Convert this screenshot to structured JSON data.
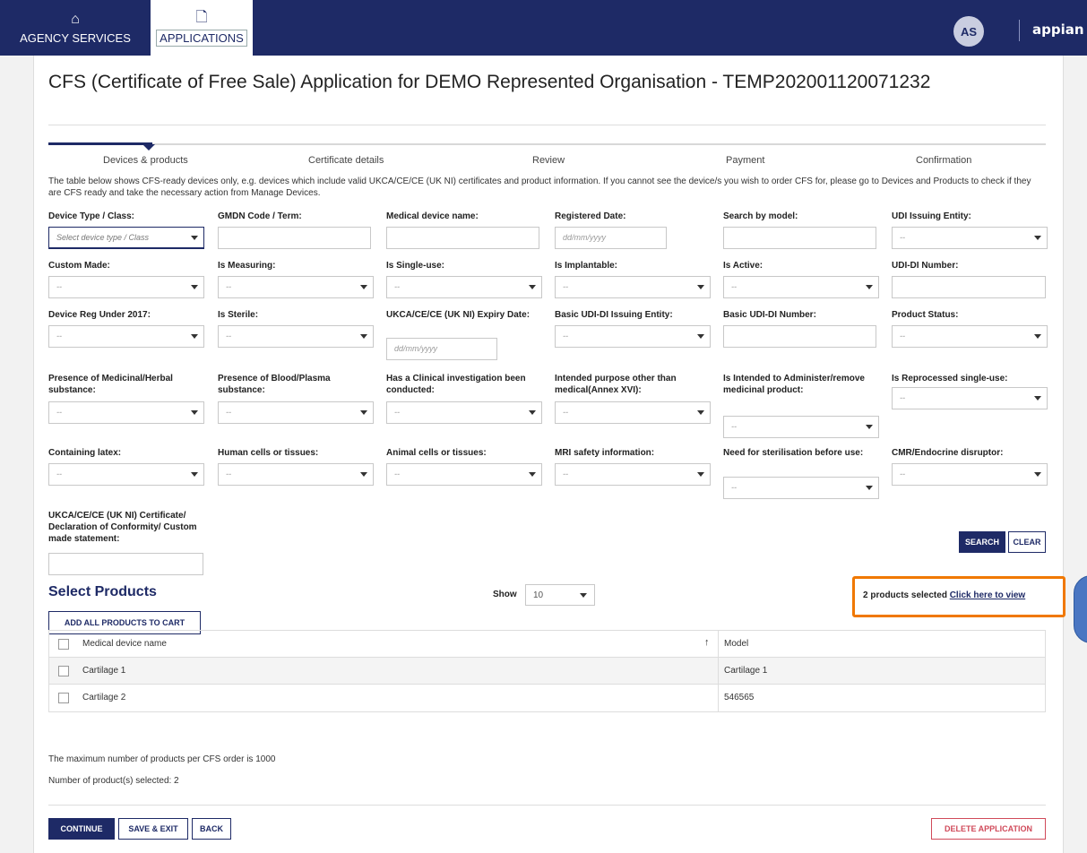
{
  "nav": {
    "agency_label": "AGENCY SERVICES",
    "applications_label": "APPLICATIONS",
    "avatar_initials": "AS",
    "brand": "appian"
  },
  "page": {
    "title": "CFS (Certificate of Free Sale) Application for DEMO Represented Organisation - TEMP202001120071232"
  },
  "steps": [
    "Devices & products",
    "Certificate details",
    "Review",
    "Payment",
    "Confirmation"
  ],
  "info_text": "The table below shows CFS-ready devices only, e.g. devices which include valid UKCA/CE/CE (UK NI) certificates and product information. If you cannot see the device/s you wish to order CFS for, please go to Devices and Products to check if they are CFS ready and take the necessary action from Manage Devices.",
  "filters": {
    "device_type": {
      "label": "Device Type / Class:",
      "placeholder": "Select device type / Class"
    },
    "gmdn": {
      "label": "GMDN Code / Term:"
    },
    "medical_device_name": {
      "label": "Medical device name:"
    },
    "registered_date": {
      "label": "Registered Date:",
      "placeholder": "dd/mm/yyyy"
    },
    "search_by_model": {
      "label": "Search by model:"
    },
    "udi_issuing_entity": {
      "label": "UDI Issuing Entity:",
      "placeholder": "--"
    },
    "custom_made": {
      "label": "Custom Made:",
      "placeholder": "--"
    },
    "is_measuring": {
      "label": "Is Measuring:",
      "placeholder": "--"
    },
    "is_single_use": {
      "label": "Is Single-use:",
      "placeholder": "--"
    },
    "is_implantable": {
      "label": "Is Implantable:",
      "placeholder": "--"
    },
    "is_active": {
      "label": "Is Active:",
      "placeholder": "--"
    },
    "udi_di_number": {
      "label": "UDI-DI Number:"
    },
    "device_reg_2017": {
      "label": "Device Reg Under 2017:",
      "placeholder": "--"
    },
    "is_sterile": {
      "label": "Is Sterile:",
      "placeholder": "--"
    },
    "expiry_date": {
      "label": "UKCA/CE/CE (UK NI) Expiry Date:",
      "placeholder": "dd/mm/yyyy"
    },
    "basic_udi_issuing": {
      "label": "Basic UDI-DI Issuing Entity:",
      "placeholder": "--"
    },
    "basic_udi_number": {
      "label": "Basic UDI-DI Number:"
    },
    "product_status": {
      "label": "Product Status:",
      "placeholder": "--"
    },
    "medicinal_substance": {
      "label": "Presence of Medicinal/Herbal substance:",
      "placeholder": "--"
    },
    "blood_plasma": {
      "label": "Presence of Blood/Plasma substance:",
      "placeholder": "--"
    },
    "clinical_investigation": {
      "label": "Has a Clinical investigation been conducted:",
      "placeholder": "--"
    },
    "intended_purpose": {
      "label": "Intended purpose other than medical(Annex XVI):",
      "placeholder": "--"
    },
    "administer_medicinal": {
      "label": "Is Intended to Administer/remove medicinal product:",
      "placeholder": "--"
    },
    "reprocessed": {
      "label": "Is Reprocessed single-use:",
      "placeholder": "--"
    },
    "latex": {
      "label": "Containing latex:",
      "placeholder": "--"
    },
    "human_cells": {
      "label": "Human cells or tissues:",
      "placeholder": "--"
    },
    "animal_cells": {
      "label": "Animal cells or tissues:",
      "placeholder": "--"
    },
    "mri_safety": {
      "label": "MRI safety information:",
      "placeholder": "--"
    },
    "sterilisation": {
      "label": "Need for sterilisation before use:",
      "placeholder": "--"
    },
    "cmr": {
      "label": "CMR/Endocrine disruptor:",
      "placeholder": "--"
    },
    "certificate": {
      "label": "UKCA/CE/CE (UK NI) Certificate/ Declaration of Conformity/ Custom made statement:"
    }
  },
  "buttons": {
    "search": "SEARCH",
    "clear": "CLEAR",
    "add_all": "ADD ALL PRODUCTS TO CART",
    "continue": "CONTINUE",
    "save_exit": "SAVE & EXIT",
    "back": "BACK",
    "delete": "DELETE APPLICATION"
  },
  "products": {
    "section_title": "Select Products",
    "show_label": "Show",
    "show_value": "10",
    "selected_text": "2 products selected",
    "view_link": "Click here to view",
    "columns": [
      "Medical device name",
      "Model"
    ],
    "rows": [
      {
        "name": "Cartilage 1",
        "model": "Cartilage 1"
      },
      {
        "name": "Cartilage 2",
        "model": "546565"
      }
    ],
    "max_note": "The maximum number of products per CFS order is 1000",
    "count_note": "Number of product(s) selected: 2"
  }
}
